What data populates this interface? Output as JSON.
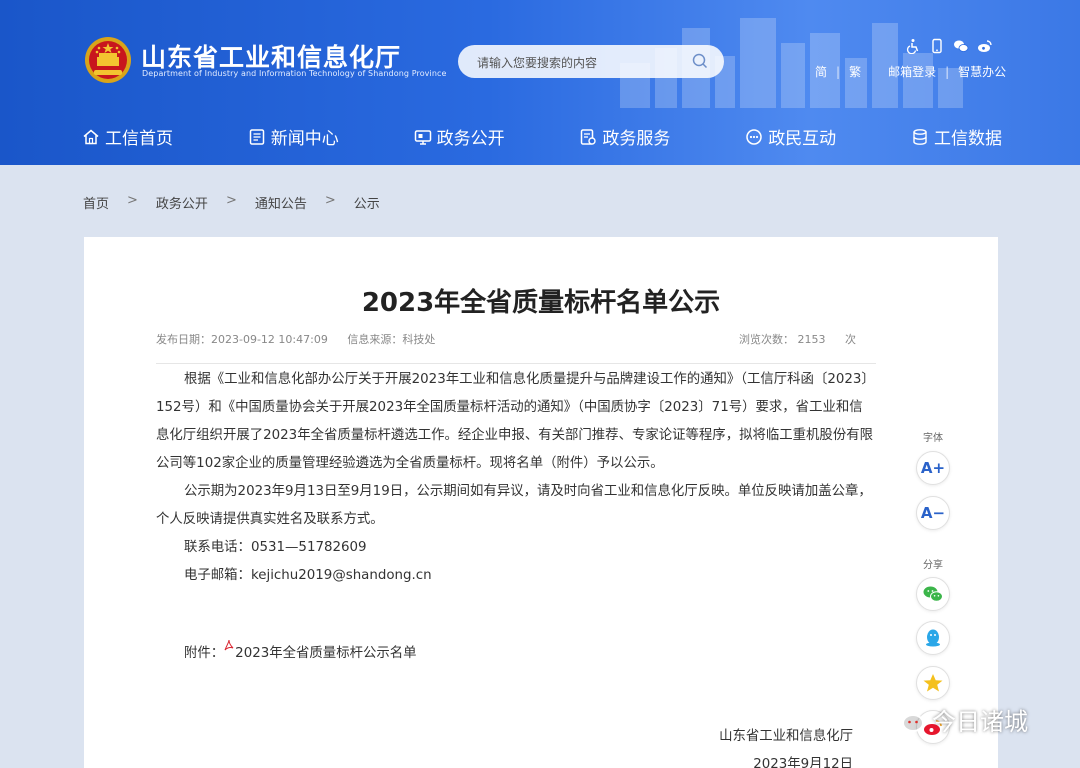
{
  "header": {
    "site_title": "山东省工业和信息化厅",
    "site_subtitle": "Department of Industry and Information Technology of Shandong Province",
    "search_placeholder": "请输入您要搜索的内容",
    "top_links": {
      "simplified": "简",
      "traditional": "繁",
      "mail_login": "邮箱登录",
      "smart_office": "智慧办公"
    },
    "tool_icons": [
      "accessibility-icon",
      "mobile-icon",
      "wechat-icon",
      "weibo-icon"
    ],
    "brand_color": "#1a56c9"
  },
  "nav": [
    {
      "label": "工信首页",
      "icon": "home-icon"
    },
    {
      "label": "新闻中心",
      "icon": "news-icon"
    },
    {
      "label": "政务公开",
      "icon": "gov-open-icon"
    },
    {
      "label": "政务服务",
      "icon": "service-icon"
    },
    {
      "label": "政民互动",
      "icon": "interaction-icon"
    },
    {
      "label": "工信数据",
      "icon": "database-icon"
    }
  ],
  "breadcrumb": {
    "items": [
      "首页",
      "政务公开",
      "通知公告",
      "公示"
    ],
    "separator": ">"
  },
  "article": {
    "title": "2023年全省质量标杆名单公示",
    "publish_date": "发布日期：2023-09-12 10:47:09",
    "source": "信息来源：科技处",
    "views_label": "浏览次数：",
    "views_count": "2153",
    "views_unit": "次",
    "paragraphs": [
      "根据《工业和信息化部办公厅关于开展2023年工业和信息化质量提升与品牌建设工作的通知》（工信厅科函〔2023〕152号）和《中国质量协会关于开展2023年全国质量标杆活动的通知》（中国质协字〔2023〕71号）要求，省工业和信息化厅组织开展了2023年全省质量标杆遴选工作。经企业申报、有关部门推荐、专家论证等程序，拟将临工重机股份有限公司等102家企业的质量管理经验遴选为全省质量标杆。现将名单（附件）予以公示。",
      "公示期为2023年9月13日至9月19日，公示期间如有异议，请及时向省工业和信息化厅反映。单位反映请加盖公章，个人反映请提供真实姓名及联系方式。"
    ],
    "contact_phone": "联系电话：0531—51782609",
    "contact_email": "电子邮箱：kejichu2019@shandong.cn",
    "attachment_label": "附件：",
    "attachment_name": "2023年全省质量标杆公示名单",
    "signature_org": "山东省工业和信息化厅",
    "signature_date": "2023年9月12日"
  },
  "side_tools": {
    "font_label": "字体",
    "font_increase": "A+",
    "font_decrease": "A−",
    "share_label": "分享",
    "share_icons": [
      "wechat-share-icon",
      "qq-share-icon",
      "qzone-share-icon",
      "weibo-share-icon"
    ]
  },
  "watermark": {
    "text": "今日诸城"
  }
}
